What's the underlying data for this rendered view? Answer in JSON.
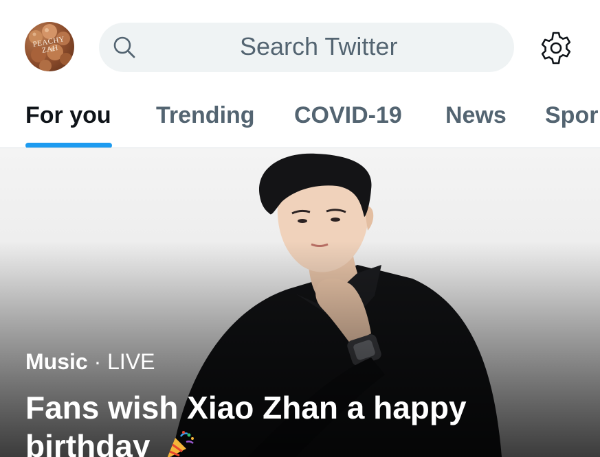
{
  "header": {
    "avatar_text": "PEACHY\nZAH",
    "search_placeholder": "Search Twitter",
    "search_icon": "search-icon",
    "settings_icon": "gear-icon"
  },
  "tabs": [
    {
      "label": "For you",
      "active": true
    },
    {
      "label": "Trending",
      "active": false
    },
    {
      "label": "COVID-19",
      "active": false
    },
    {
      "label": "News",
      "active": false
    },
    {
      "label": "Spor",
      "active": false
    }
  ],
  "hero": {
    "category": "Music",
    "separator": " · ",
    "status": "LIVE",
    "title": "Fans wish Xiao Zhan a happy birthday",
    "emoji_icon": "party-popper-icon"
  },
  "colors": {
    "accent": "#1d9bf0",
    "text_primary": "#0f1419",
    "text_secondary": "#536471",
    "search_bg": "#eff3f4"
  }
}
